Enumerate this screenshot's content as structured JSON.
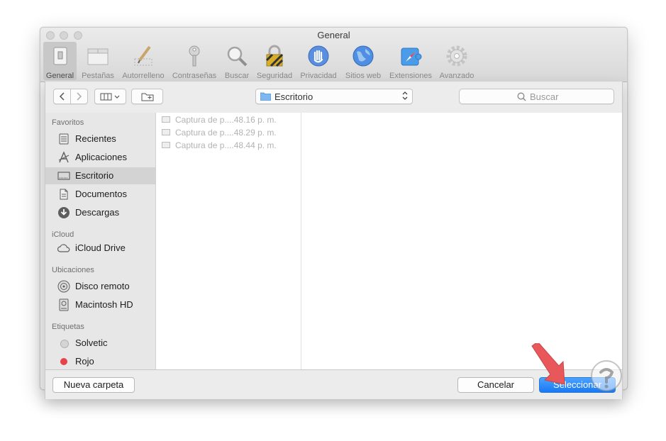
{
  "window": {
    "title": "General"
  },
  "toolbar": {
    "items": [
      {
        "label": "General",
        "icon": "switch-icon",
        "active": true
      },
      {
        "label": "Pestañas",
        "icon": "tabs-icon"
      },
      {
        "label": "Autorrelleno",
        "icon": "pencil-form-icon"
      },
      {
        "label": "Contraseñas",
        "icon": "key-icon"
      },
      {
        "label": "Buscar",
        "icon": "magnifier-icon"
      },
      {
        "label": "Seguridad",
        "icon": "lock-icon"
      },
      {
        "label": "Privacidad",
        "icon": "hand-icon"
      },
      {
        "label": "Sitios web",
        "icon": "globe-icon"
      },
      {
        "label": "Extensiones",
        "icon": "puzzle-compass-icon"
      },
      {
        "label": "Avanzado",
        "icon": "gear-icon"
      }
    ]
  },
  "dialog": {
    "location": "Escritorio",
    "search_placeholder": "Buscar",
    "sidebar": {
      "favorites_heading": "Favoritos",
      "favorites": [
        {
          "label": "Recientes",
          "icon": "recents-icon"
        },
        {
          "label": "Aplicaciones",
          "icon": "applications-icon"
        },
        {
          "label": "Escritorio",
          "icon": "desktop-icon",
          "selected": true
        },
        {
          "label": "Documentos",
          "icon": "documents-icon"
        },
        {
          "label": "Descargas",
          "icon": "downloads-icon"
        }
      ],
      "icloud_heading": "iCloud",
      "icloud": [
        {
          "label": "iCloud Drive",
          "icon": "cloud-icon"
        }
      ],
      "locations_heading": "Ubicaciones",
      "locations": [
        {
          "label": "Disco remoto",
          "icon": "disc-icon"
        },
        {
          "label": "Macintosh HD",
          "icon": "harddisk-icon"
        }
      ],
      "tags_heading": "Etiquetas",
      "tags": [
        {
          "label": "Solvetic",
          "color": "#d4d4d4"
        },
        {
          "label": "Rojo",
          "color": "#e8414a"
        }
      ]
    },
    "files": [
      "Captura de p....48.16 p. m.",
      "Captura de p....48.29 p. m.",
      "Captura de p....48.44 p. m."
    ],
    "buttons": {
      "new_folder": "Nueva carpeta",
      "cancel": "Cancelar",
      "select": "Seleccionar"
    }
  },
  "colors": {
    "accent": "#1a79f3",
    "arrow": "#e8585a",
    "tag_red": "#e8414a"
  }
}
